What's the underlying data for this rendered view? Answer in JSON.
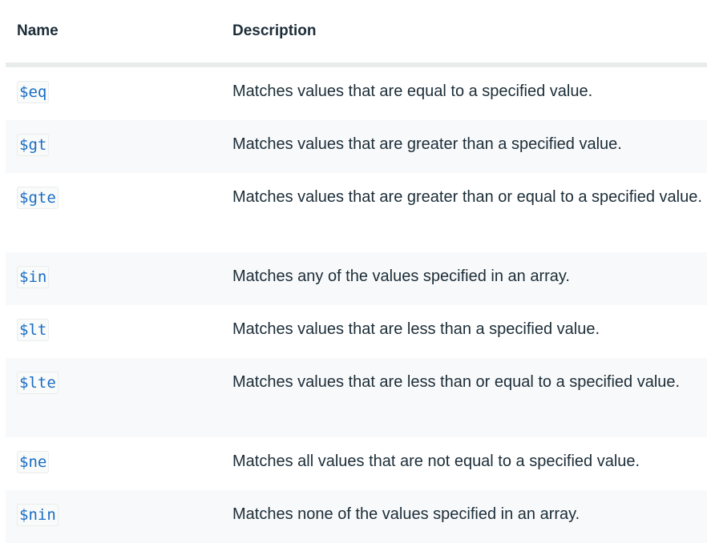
{
  "table": {
    "headers": {
      "name": "Name",
      "description": "Description"
    },
    "rows": [
      {
        "name": "$eq",
        "description": "Matches values that are equal to a specified value."
      },
      {
        "name": "$gt",
        "description": "Matches values that are greater than a specified value."
      },
      {
        "name": "$gte",
        "description": "Matches values that are greater than or equal to a specified value."
      },
      {
        "name": "$in",
        "description": "Matches any of the values specified in an array."
      },
      {
        "name": "$lt",
        "description": "Matches values that are less than a specified value."
      },
      {
        "name": "$lte",
        "description": "Matches values that are less than or equal to a specified value."
      },
      {
        "name": "$ne",
        "description": "Matches all values that are not equal to a specified value."
      },
      {
        "name": "$nin",
        "description": "Matches none of the values specified in an array."
      }
    ]
  }
}
